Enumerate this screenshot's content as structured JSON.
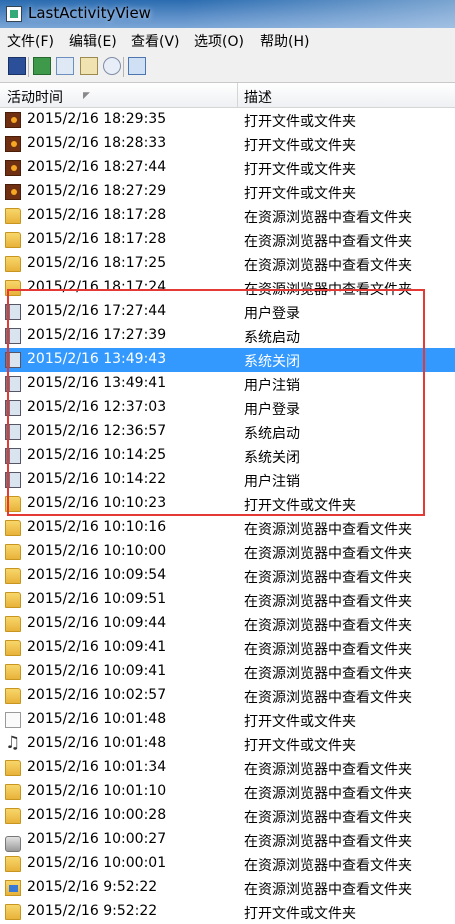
{
  "window": {
    "title": "LastActivityView"
  },
  "menu": [
    "文件(F)",
    "编辑(E)",
    "查看(V)",
    "选项(O)",
    "帮助(H)"
  ],
  "toolbar": [
    "save-icon",
    "refresh-icon",
    "copy-icon",
    "properties-icon",
    "find-icon",
    "exit-icon"
  ],
  "columns": {
    "time": "活动时间",
    "desc": "描述"
  },
  "rows": [
    {
      "time": "2015/2/16 18:29:35",
      "desc": "打开文件或文件夹",
      "icon": "media"
    },
    {
      "time": "2015/2/16 18:28:33",
      "desc": "打开文件或文件夹",
      "icon": "media"
    },
    {
      "time": "2015/2/16 18:27:44",
      "desc": "打开文件或文件夹",
      "icon": "media"
    },
    {
      "time": "2015/2/16 18:27:29",
      "desc": "打开文件或文件夹",
      "icon": "media"
    },
    {
      "time": "2015/2/16 18:17:28",
      "desc": "在资源浏览器中查看文件夹",
      "icon": "folder"
    },
    {
      "time": "2015/2/16 18:17:28",
      "desc": "在资源浏览器中查看文件夹",
      "icon": "folder"
    },
    {
      "time": "2015/2/16 18:17:25",
      "desc": "在资源浏览器中查看文件夹",
      "icon": "folder"
    },
    {
      "time": "2015/2/16 18:17:24",
      "desc": "在资源浏览器中查看文件夹",
      "icon": "folder"
    },
    {
      "time": "2015/2/16 17:27:44",
      "desc": "用户登录",
      "icon": "sys"
    },
    {
      "time": "2015/2/16 17:27:39",
      "desc": "系统启动",
      "icon": "sys"
    },
    {
      "time": "2015/2/16 13:49:43",
      "desc": "系统关闭",
      "icon": "sys",
      "selected": true
    },
    {
      "time": "2015/2/16 13:49:41",
      "desc": "用户注销",
      "icon": "sys"
    },
    {
      "time": "2015/2/16 12:37:03",
      "desc": "用户登录",
      "icon": "sys"
    },
    {
      "time": "2015/2/16 12:36:57",
      "desc": "系统启动",
      "icon": "sys"
    },
    {
      "time": "2015/2/16 10:14:25",
      "desc": "系统关闭",
      "icon": "sys"
    },
    {
      "time": "2015/2/16 10:14:22",
      "desc": "用户注销",
      "icon": "sys"
    },
    {
      "time": "2015/2/16 10:10:23",
      "desc": "打开文件或文件夹",
      "icon": "folder"
    },
    {
      "time": "2015/2/16 10:10:16",
      "desc": "在资源浏览器中查看文件夹",
      "icon": "folder"
    },
    {
      "time": "2015/2/16 10:10:00",
      "desc": "在资源浏览器中查看文件夹",
      "icon": "folder"
    },
    {
      "time": "2015/2/16 10:09:54",
      "desc": "在资源浏览器中查看文件夹",
      "icon": "folder"
    },
    {
      "time": "2015/2/16 10:09:51",
      "desc": "在资源浏览器中查看文件夹",
      "icon": "folder"
    },
    {
      "time": "2015/2/16 10:09:44",
      "desc": "在资源浏览器中查看文件夹",
      "icon": "folder"
    },
    {
      "time": "2015/2/16 10:09:41",
      "desc": "在资源浏览器中查看文件夹",
      "icon": "folder"
    },
    {
      "time": "2015/2/16 10:09:41",
      "desc": "在资源浏览器中查看文件夹",
      "icon": "folder"
    },
    {
      "time": "2015/2/16 10:02:57",
      "desc": "在资源浏览器中查看文件夹",
      "icon": "folder"
    },
    {
      "time": "2015/2/16 10:01:48",
      "desc": "打开文件或文件夹",
      "icon": "file"
    },
    {
      "time": "2015/2/16 10:01:48",
      "desc": "打开文件或文件夹",
      "icon": "music"
    },
    {
      "time": "2015/2/16 10:01:34",
      "desc": "在资源浏览器中查看文件夹",
      "icon": "folder"
    },
    {
      "time": "2015/2/16 10:01:10",
      "desc": "在资源浏览器中查看文件夹",
      "icon": "folder"
    },
    {
      "time": "2015/2/16 10:00:28",
      "desc": "在资源浏览器中查看文件夹",
      "icon": "folder"
    },
    {
      "time": "2015/2/16 10:00:27",
      "desc": "在资源浏览器中查看文件夹",
      "icon": "drive"
    },
    {
      "time": "2015/2/16 10:00:01",
      "desc": "在资源浏览器中查看文件夹",
      "icon": "folder"
    },
    {
      "time": "2015/2/16 9:52:22",
      "desc": "在资源浏览器中查看文件夹",
      "icon": "folder-pic"
    },
    {
      "time": "2015/2/16 9:52:22",
      "desc": "打开文件或文件夹",
      "icon": "folder"
    }
  ],
  "colors": {
    "selection": "#3399ff",
    "highlight_border": "#e53935"
  }
}
